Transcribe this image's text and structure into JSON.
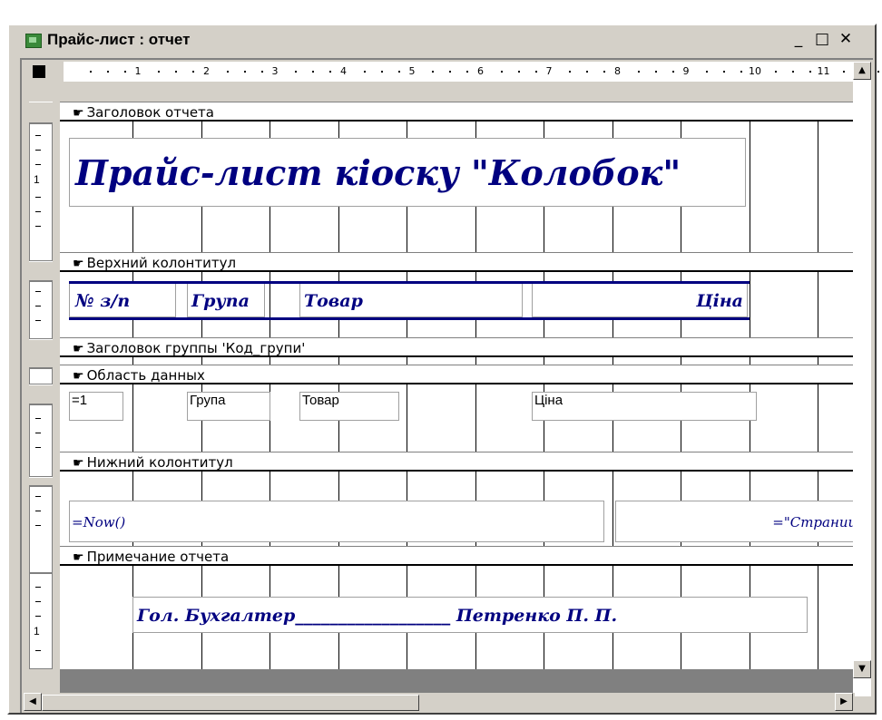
{
  "window": {
    "title": "Прайс-лист : отчет",
    "minimize": "_",
    "maximize": "□",
    "close": "✕"
  },
  "ruler": {
    "numbers": [
      "1",
      "2",
      "3",
      "4",
      "5",
      "6",
      "7",
      "8",
      "9",
      "10",
      "11"
    ]
  },
  "vertical_ruler": {
    "label": "1"
  },
  "bands": {
    "report_header": "Заголовок отчета",
    "page_header": "Верхний колонтитул",
    "group_header": "Заголовок группы 'Код_групи'",
    "detail": "Область данных",
    "page_footer": "Нижний колонтитул",
    "report_footer": "Примечание отчета"
  },
  "report_header": {
    "title": "Прайс-лист кіоску \"Колобок\""
  },
  "page_header": {
    "col_num": "№ з/п",
    "col_group": "Група",
    "col_product": "Товар",
    "col_price": "Ціна"
  },
  "detail": {
    "num": "=1",
    "group": "Група",
    "product": "Товар",
    "price": "Ціна"
  },
  "page_footer": {
    "date": "=Now()",
    "page": "=\"Страниц"
  },
  "report_footer": {
    "signature": "Гол. Бухгалтер__________________ Петренко П. П."
  },
  "colors": {
    "window_gray": "#d4d0c8",
    "label_blue": "#000080"
  }
}
